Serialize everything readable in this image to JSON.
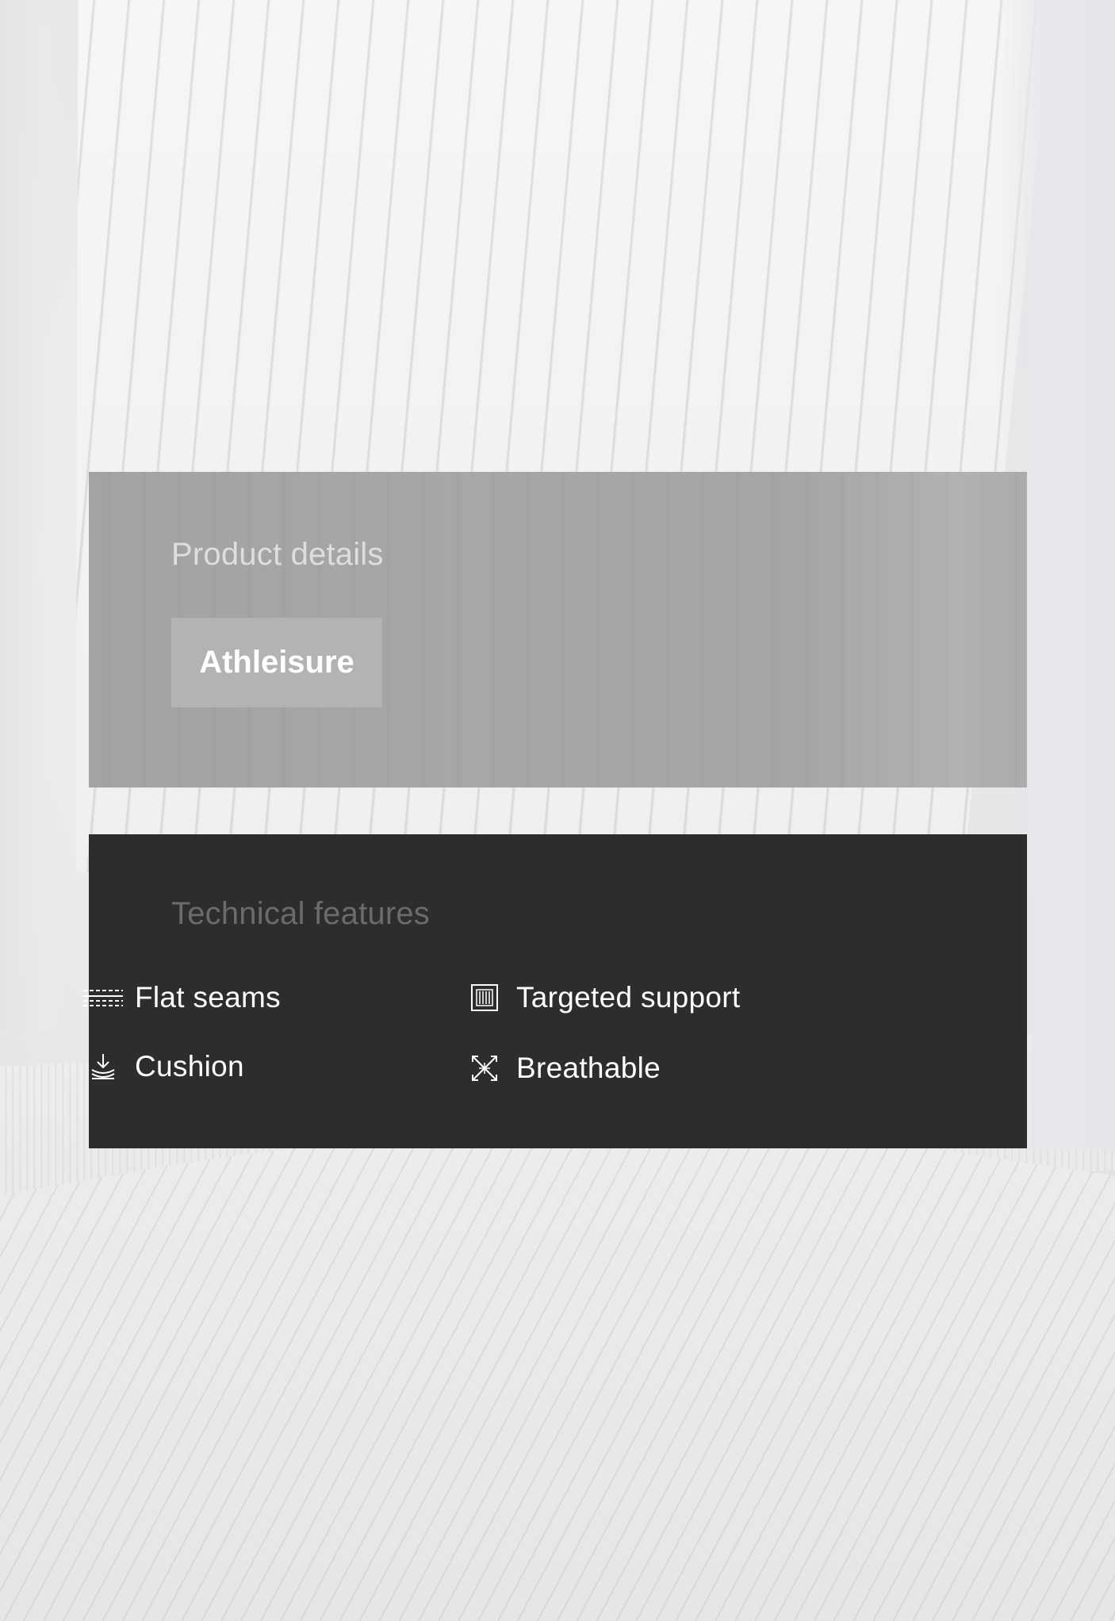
{
  "product_details": {
    "title": "Product details",
    "tag_label": "Athleisure"
  },
  "technical_features": {
    "title": "Technical features",
    "items": [
      {
        "label": "Flat seams",
        "icon": "flat-seams-icon"
      },
      {
        "label": "Targeted support",
        "icon": "targeted-support-icon"
      },
      {
        "label": "Cushion",
        "icon": "cushion-icon"
      },
      {
        "label": "Breathable",
        "icon": "breathable-icon"
      }
    ]
  },
  "colors": {
    "details_panel": "#a6a6a6",
    "features_panel": "#2d2d2e",
    "tag_background": "#b3b3b3",
    "feature_text": "#ffffff"
  }
}
